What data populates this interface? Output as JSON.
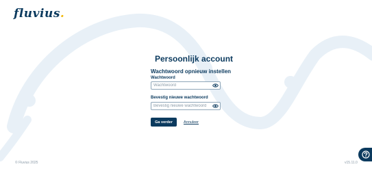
{
  "brand": {
    "logo_text": "fluvius",
    "logo_dot": ".",
    "accent": "#0b3a5e",
    "highlight": "#f2b705"
  },
  "card": {
    "title": "Persoonlijk account",
    "title_icon": "user-icon",
    "subtitle": "Wachtwoord opnieuw instellen",
    "password": {
      "label": "Wachtwoord",
      "placeholder": "Wachtwoord",
      "toggle_icon": "eye-icon"
    },
    "confirm": {
      "label": "Bevestig nieuwe wachtwoord",
      "placeholder": "Bevestig nieuwe wachtwoord",
      "toggle_icon": "eye-icon"
    },
    "primary_button": "Ga verder",
    "cancel_link": "Annuleer"
  },
  "footer": {
    "copyright": "© Fluvius 2025",
    "version": "v15.11.0"
  },
  "help": {
    "icon": "help-icon"
  }
}
